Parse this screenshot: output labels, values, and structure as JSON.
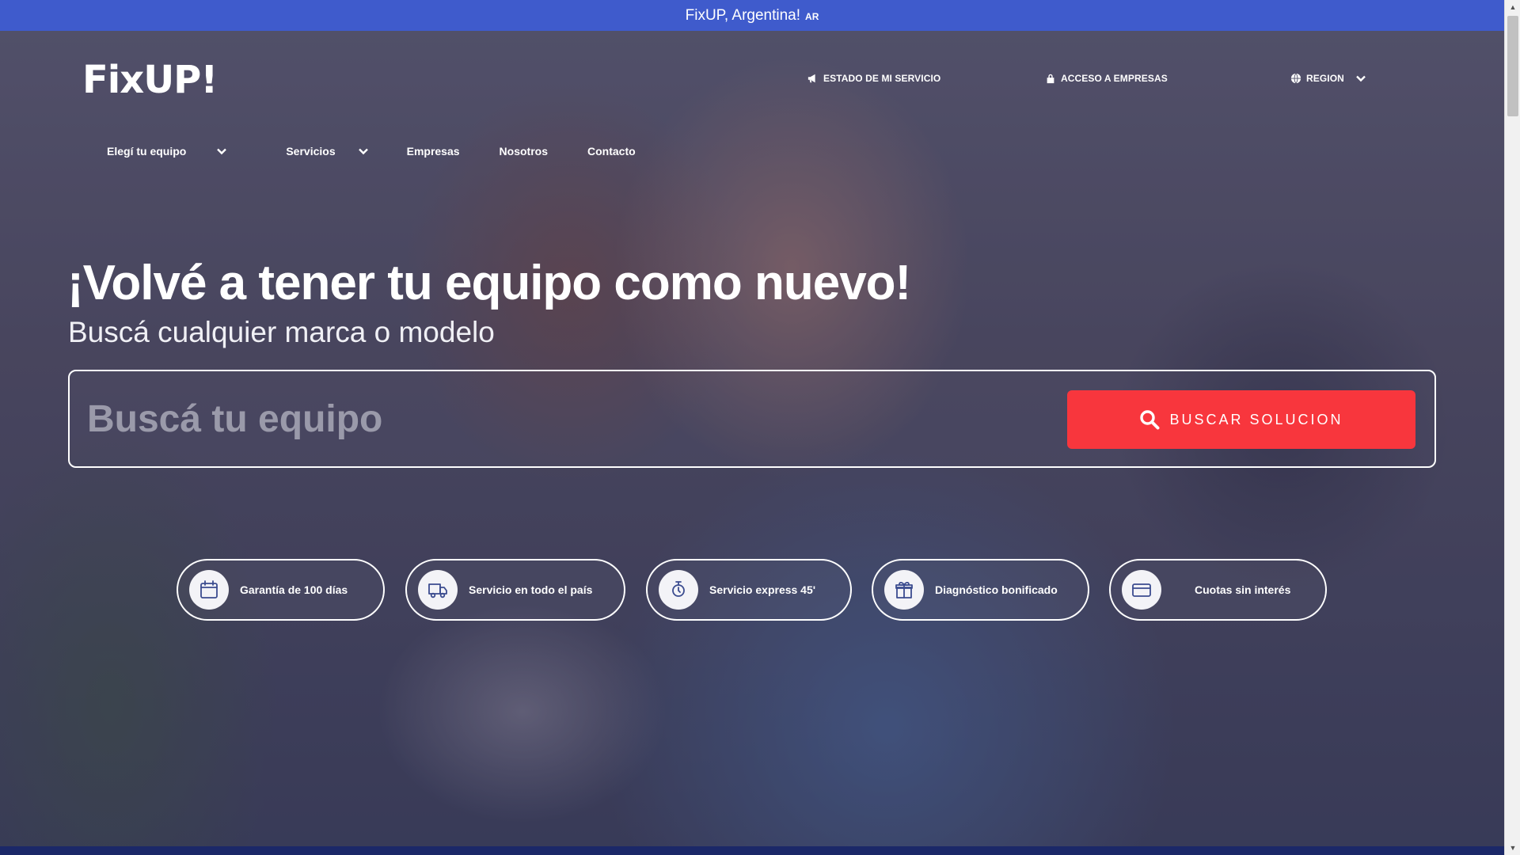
{
  "topbar": {
    "text": "FixUP, Argentina!",
    "country_code": "AR"
  },
  "header": {
    "logo": "FixUP!",
    "utility": {
      "status": "ESTADO DE MI SERVICIO",
      "business": "ACCESO A EMPRESAS",
      "region": "REGION"
    }
  },
  "nav": {
    "items": [
      "Elegí tu equipo",
      "Servicios",
      "Empresas",
      "Nosotros",
      "Contacto"
    ]
  },
  "hero": {
    "headline": "¡Volvé a tener tu equipo como nuevo!",
    "subheadline": "Buscá cualquier marca o modelo",
    "search": {
      "placeholder": "Buscá tu equipo",
      "value": "",
      "button": "BUSCAR SOLUCION"
    }
  },
  "features": [
    {
      "label": "Garantía de 100 días",
      "icon": "calendar-icon"
    },
    {
      "label": "Servicio en todo el país",
      "icon": "truck-icon"
    },
    {
      "label": "Servicio express 45'",
      "icon": "stopwatch-icon"
    },
    {
      "label": "Diagnóstico bonificado",
      "icon": "gift-icon"
    },
    {
      "label": "Cuotas sin interés",
      "icon": "credit-card-icon"
    }
  ],
  "colors": {
    "topbar": "#3f5bcc",
    "accent": "#f8363d",
    "icon_stroke": "#3b4c8f"
  }
}
